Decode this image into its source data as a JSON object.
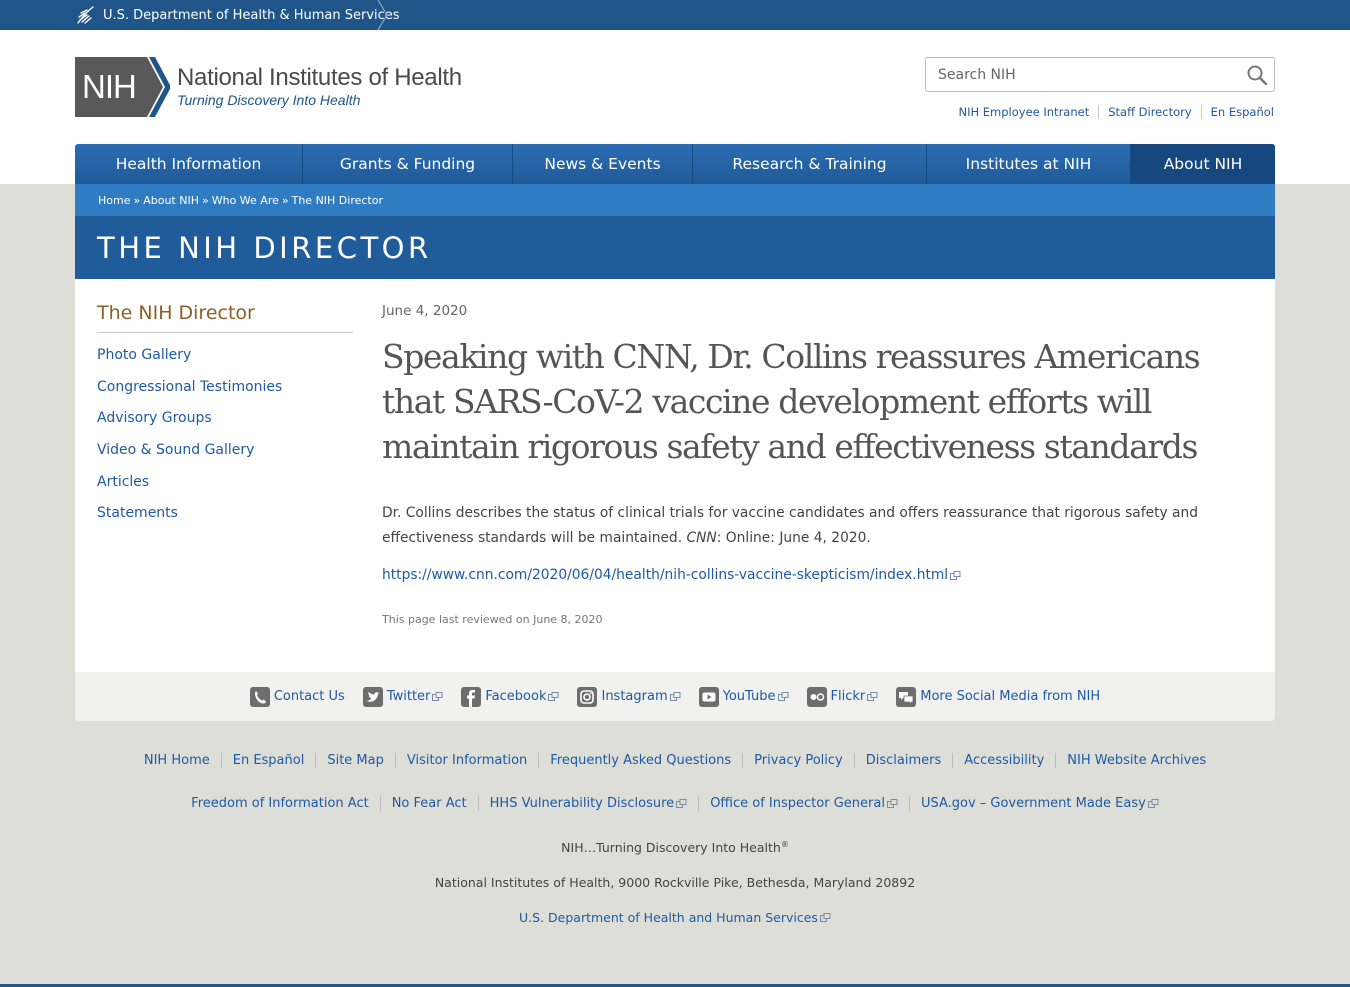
{
  "hhs": {
    "label": "U.S. Department of Health & Human Services"
  },
  "logo": {
    "abbr": "NIH",
    "name": "National Institutes of Health",
    "tagline": "Turning Discovery Into Health"
  },
  "search": {
    "placeholder": "Search NIH"
  },
  "utility_links": [
    "NIH Employee Intranet",
    "Staff Directory",
    "En Español"
  ],
  "nav": {
    "items": [
      {
        "label": "Health Information"
      },
      {
        "label": "Grants & Funding"
      },
      {
        "label": "News & Events"
      },
      {
        "label": "Research & Training"
      },
      {
        "label": "Institutes at NIH"
      },
      {
        "label": "About NIH"
      }
    ]
  },
  "breadcrumb": [
    "Home",
    "About NIH",
    "Who We Are",
    "The NIH Director"
  ],
  "page_title": "THE NIH DIRECTOR",
  "sidebar": {
    "title": "The NIH Director",
    "items": [
      "Photo Gallery",
      "Congressional Testimonies",
      "Advisory Groups",
      "Video & Sound Gallery",
      "Articles",
      "Statements"
    ]
  },
  "article": {
    "date": "June 4, 2020",
    "headline": "Speaking with CNN, Dr. Collins reassures Americans that SARS-CoV-2 vaccine development efforts will maintain rigorous safety and effectiveness standards",
    "summary": "Dr. Collins describes the status of clinical trials for vaccine candidates and offers reassurance that rigorous safety and effectiveness standards will be maintained.",
    "source": "CNN",
    "source_suffix": ": Online: June 4, 2020.",
    "url": "https://www.cnn.com/2020/06/04/health/nih-collins-vaccine-skepticism/index.html",
    "reviewed": "This page last reviewed on June 8, 2020"
  },
  "social": [
    {
      "label": "Contact Us"
    },
    {
      "label": "Twitter"
    },
    {
      "label": "Facebook"
    },
    {
      "label": "Instagram"
    },
    {
      "label": "YouTube"
    },
    {
      "label": "Flickr"
    },
    {
      "label": "More Social Media from NIH"
    }
  ],
  "footer": {
    "row1": [
      "NIH Home",
      "En Español",
      "Site Map",
      "Visitor Information",
      "Frequently Asked Questions",
      "Privacy Policy",
      "Disclaimers",
      "Accessibility",
      "NIH Website Archives"
    ],
    "row2": [
      "Freedom of Information Act",
      "No Fear Act",
      "HHS Vulnerability Disclosure",
      "Office of Inspector General",
      "USA.gov – Government Made Easy"
    ],
    "tagline": "NIH…Turning Discovery Into Health",
    "tagline_mark": "®",
    "address": "National Institutes of Health, 9000 Rockville Pike, Bethesda, Maryland 20892",
    "hhs_link": "U.S. Department of Health and Human Services"
  },
  "colors": {
    "hhs_bar": "#20558a",
    "nav": "#2c6db3",
    "nav_active": "#17477f",
    "crumb": "#2f7cc3",
    "title_bar": "#205b9a",
    "link": "#1e5aa3",
    "sidebar_title": "#8d5f23",
    "page_bg": "#deded9"
  }
}
